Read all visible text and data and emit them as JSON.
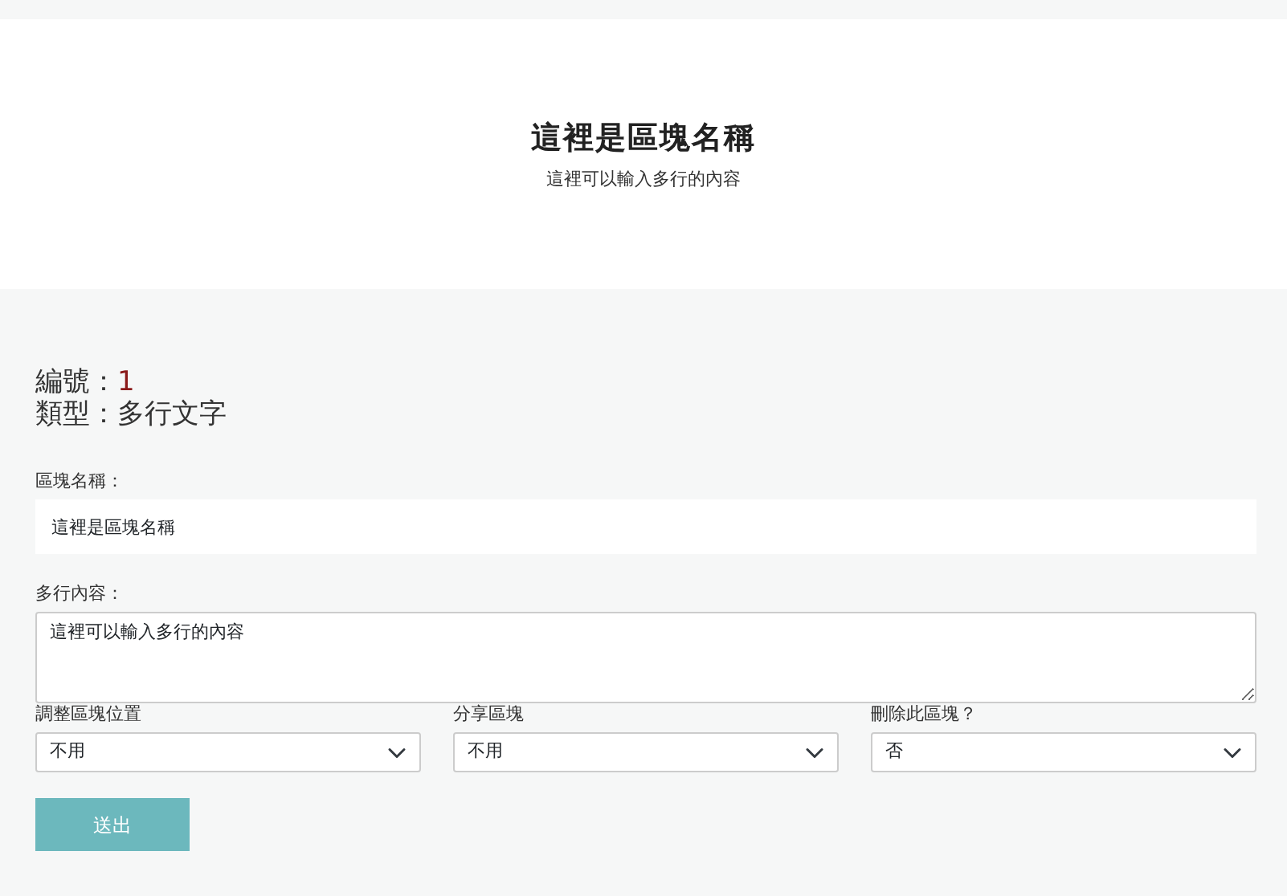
{
  "header": {
    "title": "這裡是區塊名稱",
    "subtitle": "這裡可以輸入多行的內容"
  },
  "info": {
    "number_label": "編號：",
    "number": "1",
    "type_label": "類型：",
    "type": "多行文字"
  },
  "name_field": {
    "label": "區塊名稱：",
    "value": "這裡是區塊名稱"
  },
  "content_field": {
    "label": "多行內容：",
    "value": "這裡可以輸入多行的內容"
  },
  "selects": [
    {
      "label": "調整區塊位置",
      "value": "不用"
    },
    {
      "label": "分享區塊",
      "value": "不用"
    },
    {
      "label": "刪除此區塊？",
      "value": "否"
    }
  ],
  "submit_button": "送出"
}
